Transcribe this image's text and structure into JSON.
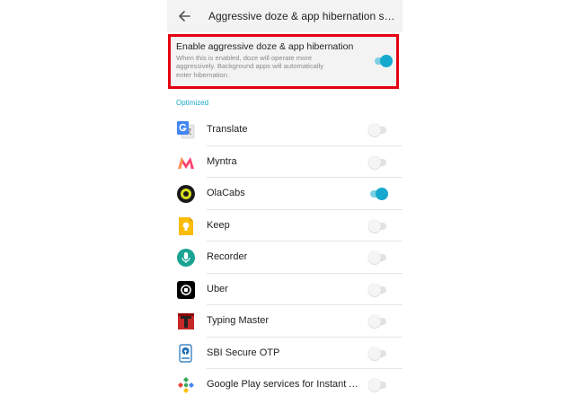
{
  "header": {
    "title": "Aggressive doze & app hibernation setti..."
  },
  "master": {
    "title": "Enable aggressive doze & app hibernation",
    "description": "When this is enabled, doze will operate more aggressively. Background apps will automatically enter hibernation.",
    "enabled": true
  },
  "section_label": "Optimized",
  "apps": [
    {
      "label": "Translate",
      "icon": "google-translate-icon",
      "enabled": false
    },
    {
      "label": "Myntra",
      "icon": "myntra-icon",
      "enabled": false
    },
    {
      "label": "OlaCabs",
      "icon": "olacabs-icon",
      "enabled": true
    },
    {
      "label": "Keep",
      "icon": "google-keep-icon",
      "enabled": false
    },
    {
      "label": "Recorder",
      "icon": "recorder-icon",
      "enabled": false
    },
    {
      "label": "Uber",
      "icon": "uber-icon",
      "enabled": false
    },
    {
      "label": "Typing Master",
      "icon": "typing-master-icon",
      "enabled": false
    },
    {
      "label": "SBI Secure OTP",
      "icon": "sbi-secure-otp-icon",
      "enabled": false
    },
    {
      "label": "Google Play services for Instant Ap...",
      "icon": "google-play-services-icon",
      "enabled": false
    }
  ],
  "colors": {
    "accent": "#16a9cf",
    "highlight_border": "#e4000f",
    "section_label": "#19a7c9"
  }
}
